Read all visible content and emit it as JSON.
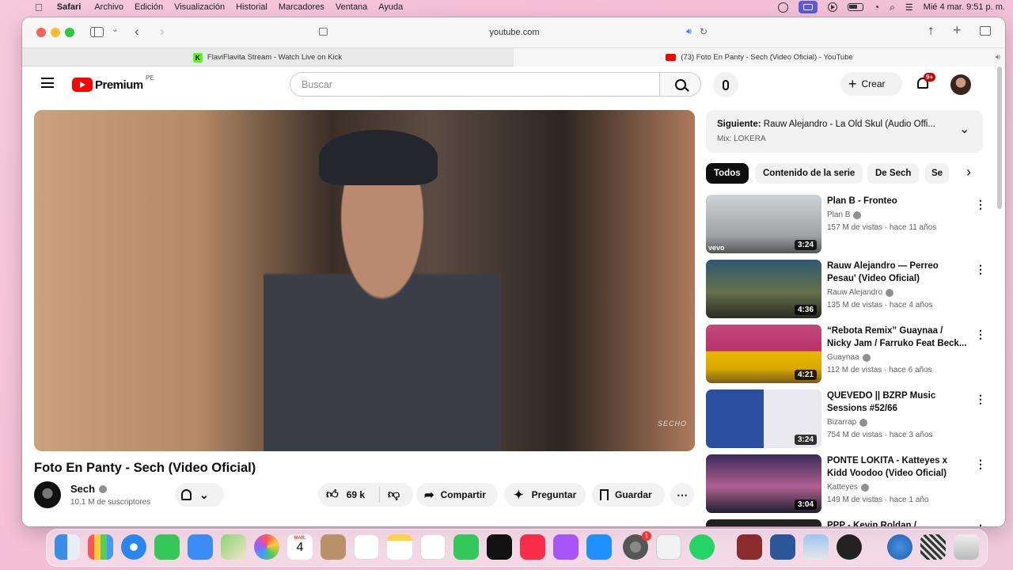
{
  "menubar": {
    "app": "Safari",
    "items": [
      "Archivo",
      "Edición",
      "Visualización",
      "Historial",
      "Marcadores",
      "Ventana",
      "Ayuda"
    ],
    "datetime": "Mié 4 mar.  9:51 p. m."
  },
  "browser": {
    "url": "youtube.com",
    "tabs": [
      {
        "title": "FlaviFlavita Stream - Watch Live on Kick",
        "icon": "kick-icon"
      },
      {
        "title": "(73) Foto En Panty - Sech (Video Oficial) - YouTube",
        "icon": "youtube-icon"
      }
    ]
  },
  "youtube": {
    "logo_text": "Premium",
    "region": "PE",
    "search_placeholder": "Buscar",
    "create_label": "Crear",
    "notifications_badge": "9+",
    "video": {
      "watermark": "SECHO",
      "title": "Foto En Panty - Sech (Video Oficial)",
      "channel": "Sech",
      "subscribers": "10.1 M de suscriptores",
      "likes": "69 k",
      "share": "Compartir",
      "ask": "Preguntar",
      "save": "Guardar"
    },
    "next": {
      "label": "Siguiente:",
      "title": "Rauw Alejandro - La Old Skul (Audio Offi...",
      "mix": "Mix: LOKERA"
    },
    "chips": [
      "Todos",
      "Contenido de la serie",
      "De Sech",
      "Se"
    ],
    "recommendations": [
      {
        "title": "Plan B - Fronteo",
        "channel": "Plan B",
        "meta": "157 M de vistas · hace 11 años",
        "duration": "3:24"
      },
      {
        "title": "Rauw Alejandro — Perreo Pesau' (Video Oficial)",
        "channel": "Rauw Alejandro",
        "meta": "135 M de vistas · hace 4 años",
        "duration": "4:36"
      },
      {
        "title": "“Rebota Remix” Guaynaa / Nicky Jam / Farruko Feat Beck...",
        "channel": "Guaynaa",
        "meta": "112 M de vistas · hace 6 años",
        "duration": "4:21"
      },
      {
        "title": "QUEVEDO || BZRP Music Sessions #52/66",
        "channel": "Bizarrap",
        "meta": "754 M de vistas · hace 3 años",
        "duration": "3:24"
      },
      {
        "title": "PONTE LOKITA - Katteyes x Kidd Voodoo (Video Oficial)",
        "channel": "Katteyes",
        "meta": "149 M de vistas · hace 1 año",
        "duration": "3:04"
      },
      {
        "title": "PPP - Kevin Roldan /",
        "channel": "",
        "meta": "",
        "duration": ""
      }
    ]
  },
  "dock": {
    "calendar_month": "MAR.",
    "calendar_day": "4",
    "settings_badge": "1"
  }
}
